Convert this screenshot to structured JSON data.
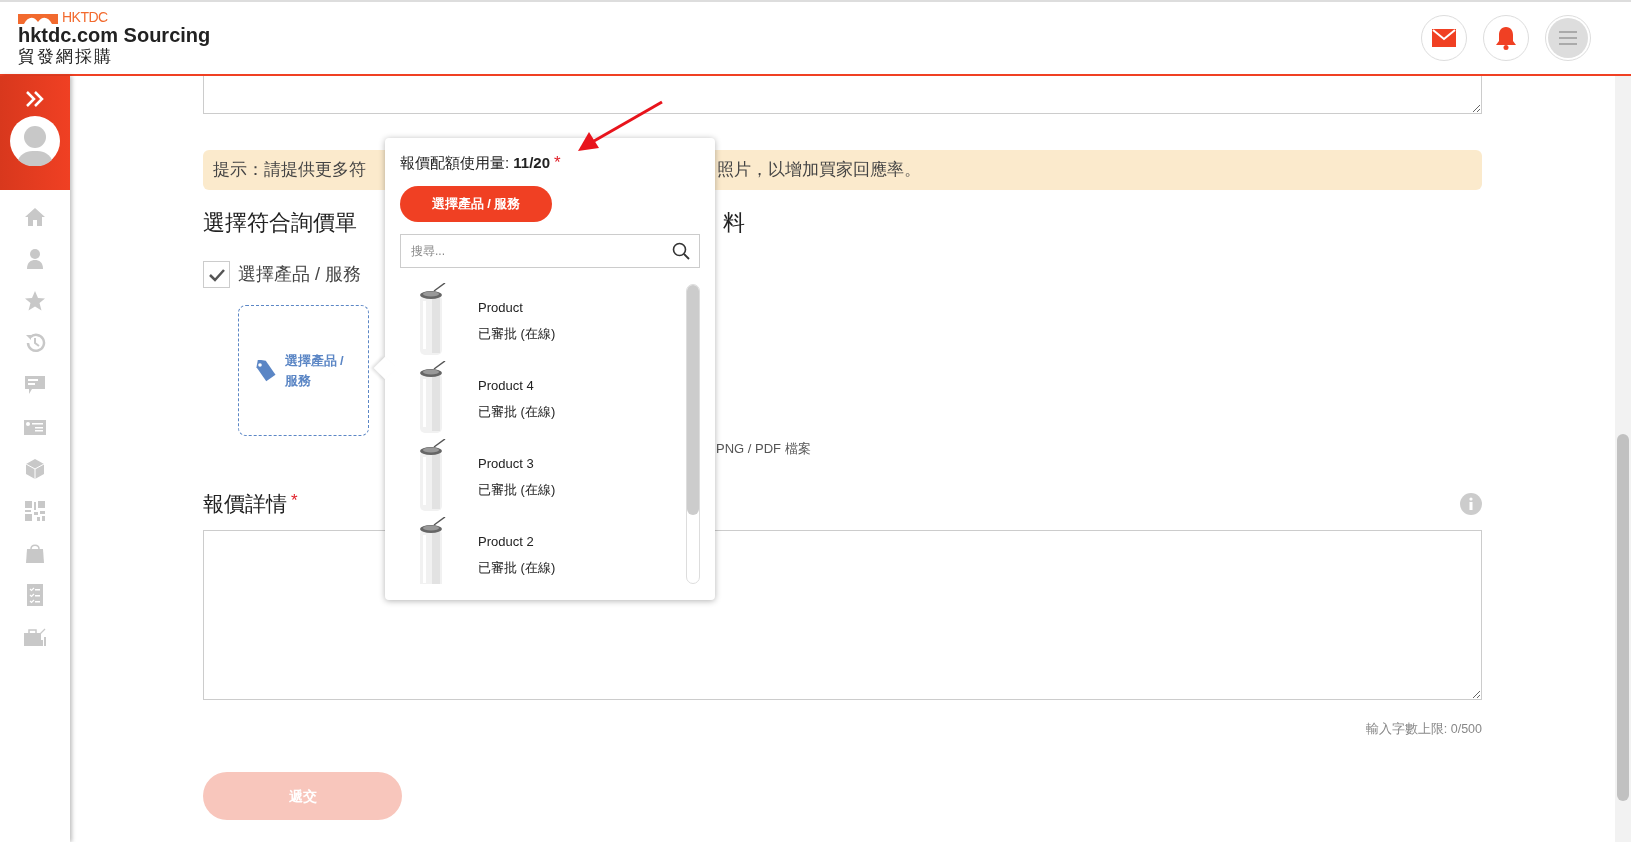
{
  "header": {
    "logo_text": "HKTDC",
    "title": "hktdc.com Sourcing",
    "subtitle": "貿發網採購"
  },
  "form": {
    "hint_left": "提示：請提供更多符",
    "hint_right": "照片，以增加買家回應率。",
    "heading_left": "選擇符合詢價單",
    "heading_right": "料",
    "checkbox": {
      "label": "選擇產品 / 服務",
      "checked": true
    },
    "select_tile": {
      "label": "選擇產品 / 服務"
    },
    "file_note": "PNG / PDF 檔案",
    "details": {
      "label": "報價詳情",
      "required_mark": "*",
      "char_limit": "輸入字數上限: 0/500"
    },
    "submit": {
      "label": "遞交",
      "disabled": true
    }
  },
  "popover": {
    "quota": "報價配額使用量: **11/20**",
    "required_mark": "*",
    "button": "選擇產品 / 服務",
    "search": {
      "placeholder": "搜尋..."
    },
    "products": [
      {
        "name": "Product",
        "status": "已審批 (在線)"
      },
      {
        "name": "Product 4",
        "status": "已審批 (在線)"
      },
      {
        "name": "Product 3",
        "status": "已審批 (在線)"
      },
      {
        "name": "Product 2",
        "status": "已審批 (在線)"
      }
    ]
  }
}
